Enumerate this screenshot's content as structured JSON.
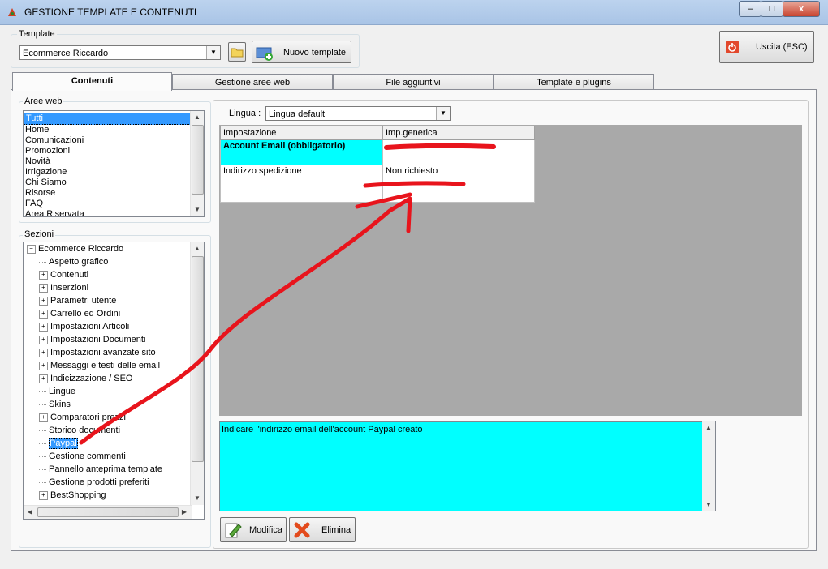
{
  "window": {
    "title": "GESTIONE TEMPLATE E CONTENUTI",
    "min": "–",
    "max": "□",
    "close": "x"
  },
  "template": {
    "legend": "Template",
    "selected": "Ecommerce Riccardo",
    "new_label": "Nuovo template"
  },
  "exit": {
    "label": "Uscita (ESC)"
  },
  "tabs": [
    {
      "label": "Contenuti"
    },
    {
      "label": "Gestione aree web"
    },
    {
      "label": "File aggiuntivi"
    },
    {
      "label": "Template e plugins"
    }
  ],
  "aree": {
    "legend": "Aree web",
    "items": [
      "Tutti",
      "Home",
      "Comunicazioni",
      "Promozioni",
      "Novità",
      "Irrigazione",
      "Chi Siamo",
      "Risorse",
      "FAQ",
      "Area Riservata"
    ]
  },
  "sezioni": {
    "legend": "Sezioni",
    "root": "Ecommerce Riccardo",
    "items": [
      {
        "label": "Aspetto grafico",
        "exp": false
      },
      {
        "label": "Contenuti",
        "exp": true
      },
      {
        "label": "Inserzioni",
        "exp": true
      },
      {
        "label": "Parametri utente",
        "exp": true
      },
      {
        "label": "Carrello ed Ordini",
        "exp": true
      },
      {
        "label": "Impostazioni Articoli",
        "exp": true
      },
      {
        "label": "Impostazioni Documenti",
        "exp": true
      },
      {
        "label": "Impostazioni avanzate sito",
        "exp": true
      },
      {
        "label": "Messaggi e testi delle email",
        "exp": true
      },
      {
        "label": "Indicizzazione / SEO",
        "exp": true
      },
      {
        "label": "Lingue",
        "exp": false
      },
      {
        "label": "Skins",
        "exp": false
      },
      {
        "label": "Comparatori prezzi",
        "exp": true
      },
      {
        "label": "Storico documenti",
        "exp": false
      },
      {
        "label": "Paypal",
        "exp": false
      },
      {
        "label": "Gestione commenti",
        "exp": false
      },
      {
        "label": "Pannello anteprima template",
        "exp": false
      },
      {
        "label": "Gestione prodotti preferiti",
        "exp": false
      },
      {
        "label": "BestShopping",
        "exp": true
      }
    ]
  },
  "lingua": {
    "label": "Lingua :",
    "selected": "Lingua default"
  },
  "grid": {
    "headers": [
      "Impostazione",
      "Imp.generica"
    ],
    "rows": [
      {
        "setting": "Account Email (obbligatorio)",
        "value": ""
      },
      {
        "setting": "Indirizzo spedizione",
        "value": "Non richiesto"
      }
    ]
  },
  "description": "Indicare l'indirizzo email dell'account Paypal creato",
  "actions": {
    "modify": "Modifica",
    "delete": "Elimina"
  },
  "colors": {
    "highlight": "#00ffff",
    "selection": "#3399ff",
    "annotation": "#e8141c"
  }
}
